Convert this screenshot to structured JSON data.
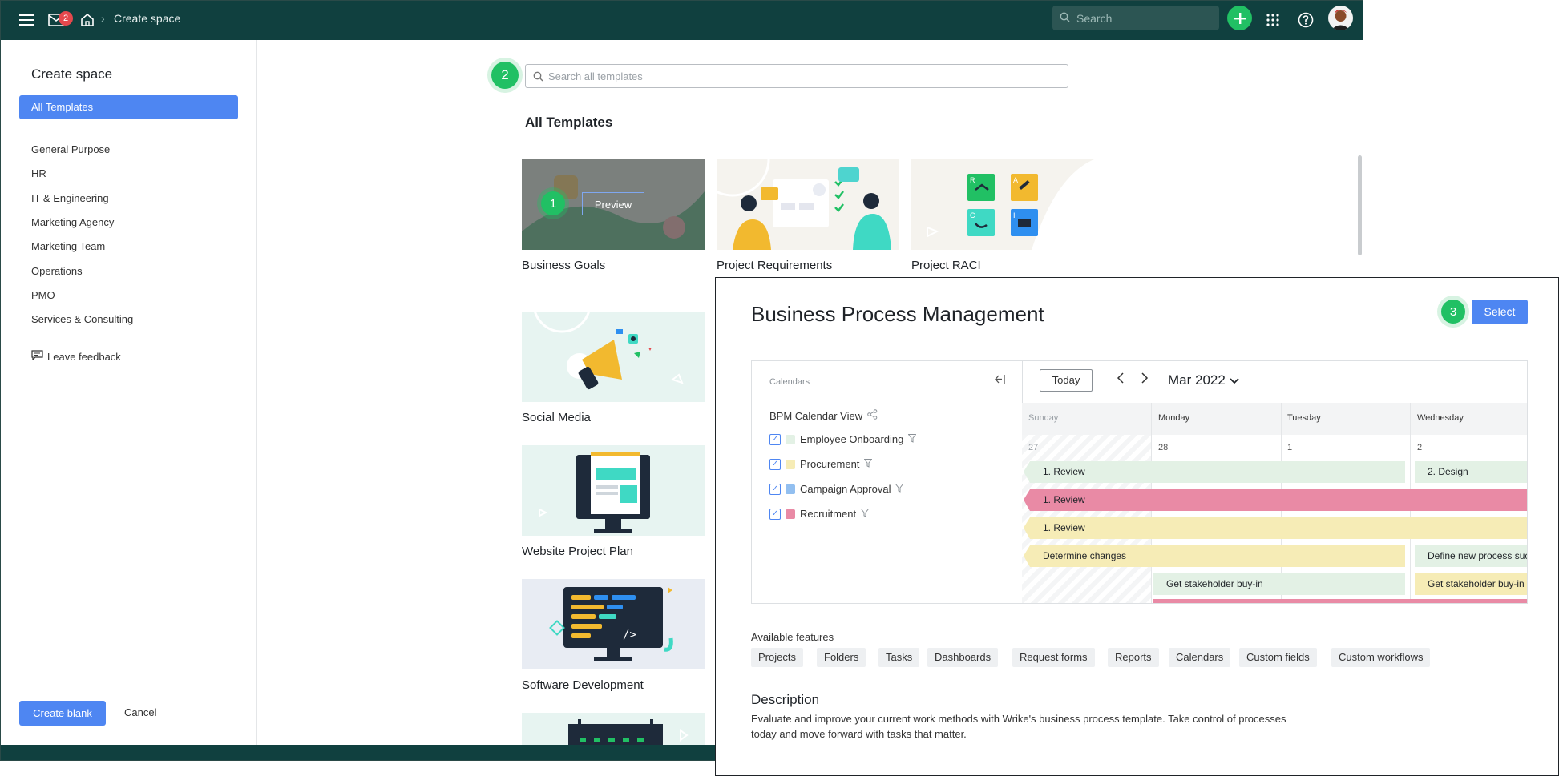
{
  "topbar": {
    "mail_badge": "2",
    "breadcrumb": "Create space",
    "search_placeholder": "Search"
  },
  "sidebar": {
    "title": "Create space",
    "active_item": "All Templates",
    "items": [
      "General Purpose",
      "HR",
      "IT & Engineering",
      "Marketing Agency",
      "Marketing Team",
      "Operations",
      "PMO",
      "Services & Consulting"
    ],
    "feedback": "Leave feedback",
    "create_blank": "Create blank",
    "cancel": "Cancel"
  },
  "main": {
    "search_step": "2",
    "search_placeholder": "Search all templates",
    "section_title": "All Templates",
    "preview_label": "Preview",
    "preview_step": "1",
    "cards": [
      "Business Goals",
      "Project Requirements",
      "Project RACI",
      "Social Media",
      "Website Project Plan",
      "Software Development"
    ]
  },
  "panel": {
    "title": "Business Process Management",
    "step": "3",
    "select_label": "Select",
    "calendar": {
      "calendars_label": "Calendars",
      "view_name": "BPM Calendar View",
      "calendars": [
        {
          "name": "Employee Onboarding",
          "color": "#e3f1e5"
        },
        {
          "name": "Procurement",
          "color": "#f6ecb6"
        },
        {
          "name": "Campaign Approval",
          "color": "#92bff0"
        },
        {
          "name": "Recruitment",
          "color": "#e98aa5"
        }
      ],
      "today_label": "Today",
      "month": "Mar 2022",
      "days": [
        "Sunday",
        "Monday",
        "Tuesday",
        "Wednesday"
      ],
      "dates": [
        "27",
        "28",
        "1",
        "2"
      ],
      "events": {
        "e1": "1. Review",
        "e2": "2. Design",
        "e3": "1. Review",
        "e4": "1. Review",
        "e5": "Determine changes",
        "e6": "Define new process suc",
        "e7": "Get stakeholder buy-in",
        "e8": "Get stakeholder buy-in"
      }
    },
    "features_title": "Available features",
    "features": [
      "Projects",
      "Folders",
      "Tasks",
      "Dashboards",
      "Request forms",
      "Reports",
      "Calendars",
      "Custom fields",
      "Custom workflows"
    ],
    "description_title": "Description",
    "description": "Evaluate and improve your current work methods with Wrike's business process template. Take control of processes today and move forward with tasks that matter."
  }
}
